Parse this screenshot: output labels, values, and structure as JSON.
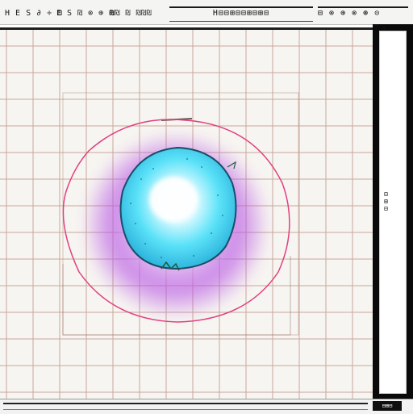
{
  "toolbar": {
    "groups": [
      {
        "text": "H E S ∂ ÷ ⊡",
        "name": "toolbar-group-1"
      },
      {
        "text": "E S ₪ ⊗ ⊕ ⊞",
        "name": "toolbar-group-2"
      },
      {
        "text": "₪₪ ₪ ₪₪₪",
        "name": "toolbar-group-3"
      }
    ],
    "title_text": "H⊟⊟⊞⊟⊟⊞⊟⊞⊟",
    "controls_text": "⊟ ⊗ ⊕ ⊗ ⊛ ⊝"
  },
  "side_panel": {
    "label": "T ⊞",
    "marker": "⊟\n⊞\n⊟"
  },
  "bottom": {
    "corner_text": "⊟⊞⊟"
  },
  "colors": {
    "grid": "#b98f7f",
    "outer_ring": "#e04080",
    "glow_purple": "#b34be3",
    "core_cyan": "#37d6f5",
    "core_outline": "#1a4d66",
    "center_white": "#ffffff"
  }
}
